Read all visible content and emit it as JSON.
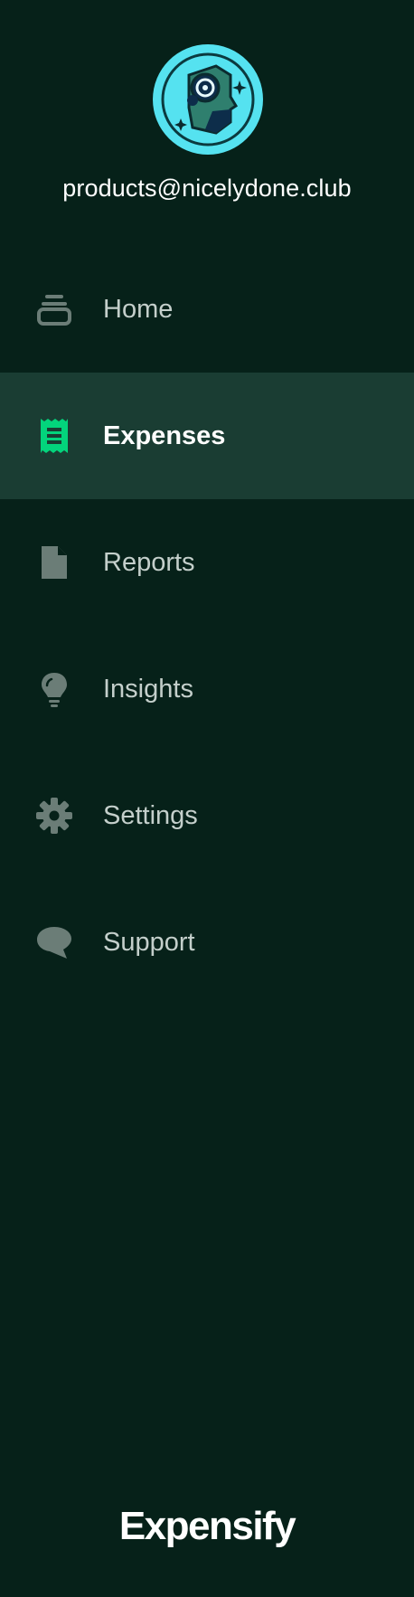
{
  "account": {
    "email": "products@nicelydone.club",
    "avatar_icon": "robot-avatar"
  },
  "nav": {
    "items": [
      {
        "label": "Home",
        "icon": "inbox-stack-icon",
        "active": false
      },
      {
        "label": "Expenses",
        "icon": "receipt-icon",
        "active": true
      },
      {
        "label": "Reports",
        "icon": "document-icon",
        "active": false
      },
      {
        "label": "Insights",
        "icon": "lightbulb-icon",
        "active": false
      },
      {
        "label": "Settings",
        "icon": "gear-icon",
        "active": false
      },
      {
        "label": "Support",
        "icon": "chat-bubble-icon",
        "active": false
      }
    ]
  },
  "brand": {
    "name": "Expensify"
  },
  "colors": {
    "background": "#062119",
    "active_row": "#1a3d33",
    "active_icon": "#03d47c",
    "inactive_icon": "#6b7d77",
    "inactive_text": "#c4cfcb",
    "avatar_bg": "#55e2f0"
  }
}
